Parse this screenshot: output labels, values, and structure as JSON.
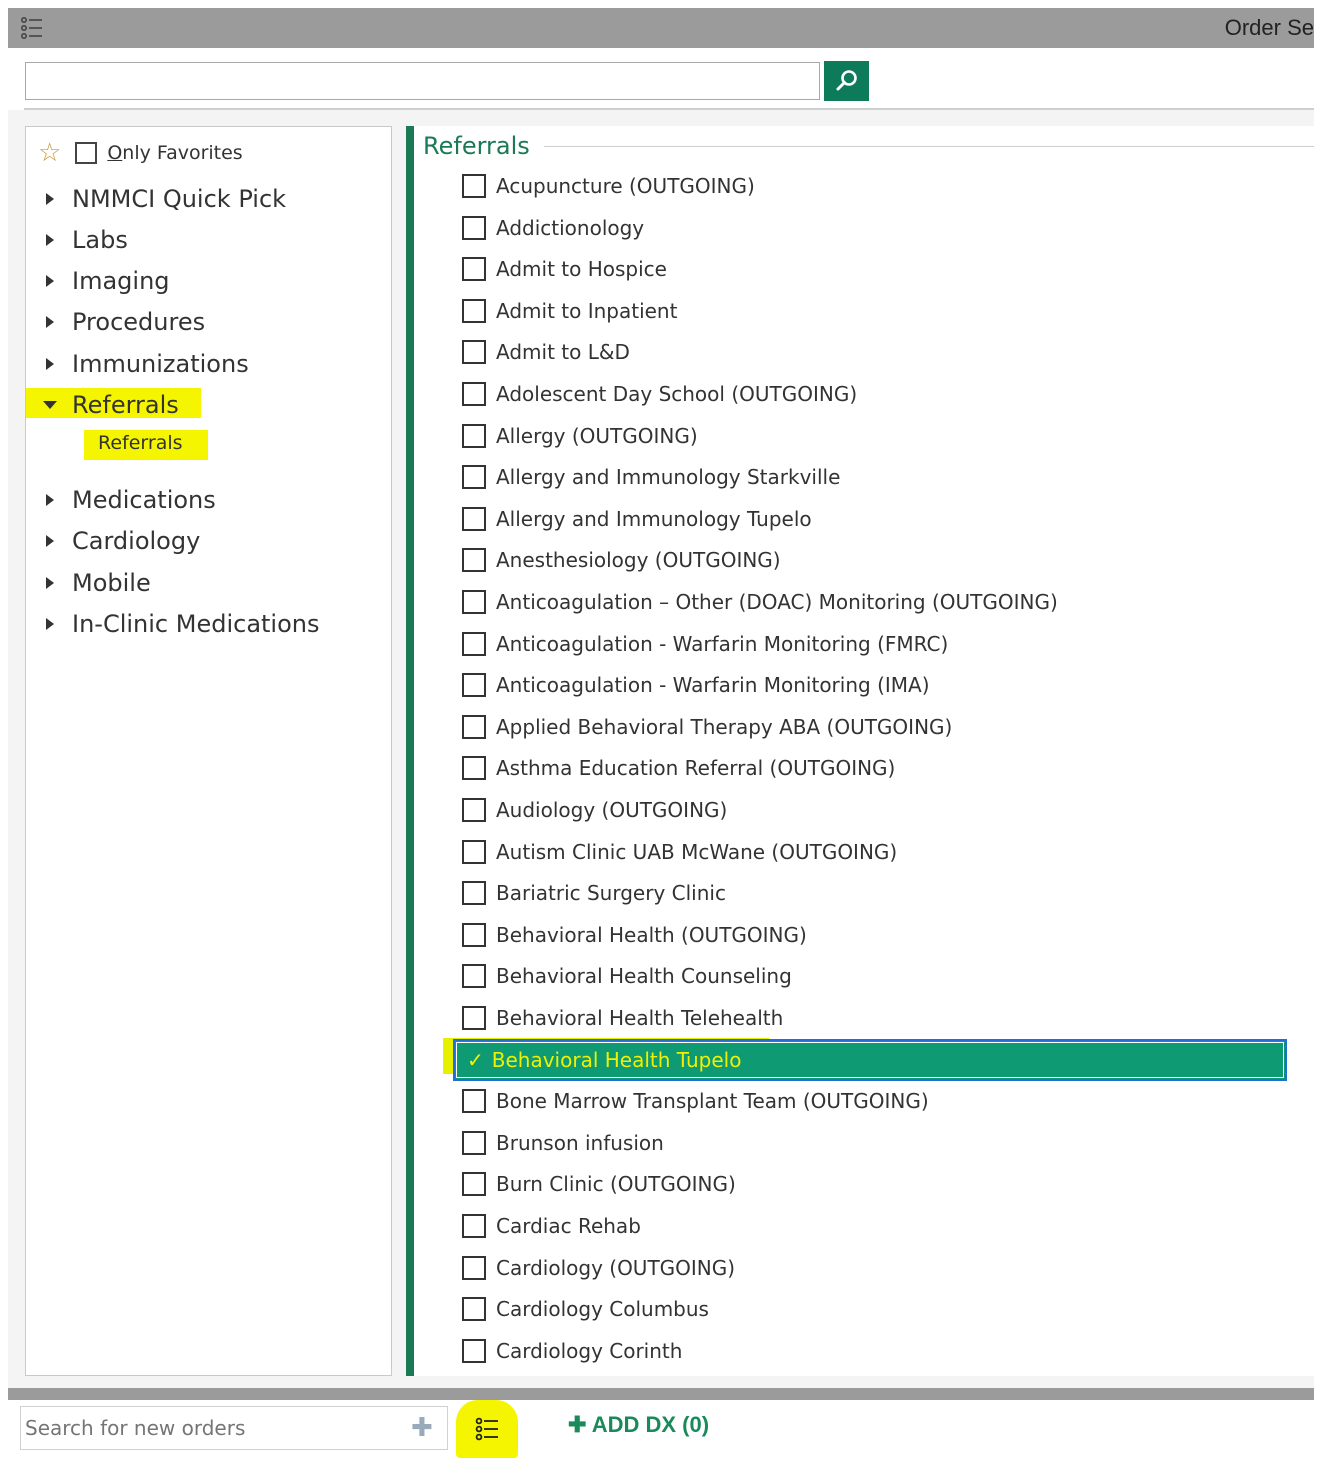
{
  "window": {
    "title": "Order Se"
  },
  "search": {
    "value": "",
    "placeholder": ""
  },
  "favorites": {
    "label_u": "O",
    "label_rest": "nly Favorites",
    "checked": false
  },
  "tree": [
    {
      "label": "NMMCI Quick Pick",
      "expanded": false
    },
    {
      "label": "Labs",
      "expanded": false
    },
    {
      "label": "Imaging",
      "expanded": false
    },
    {
      "label": "Procedures",
      "expanded": false
    },
    {
      "label": "Immunizations",
      "expanded": false
    },
    {
      "label": "Referrals",
      "expanded": true,
      "children": [
        "Referrals"
      ]
    },
    {
      "label": "Medications",
      "expanded": false
    },
    {
      "label": "Cardiology",
      "expanded": false
    },
    {
      "label": "Mobile",
      "expanded": false
    },
    {
      "label": "In-Clinic Medications",
      "expanded": false
    }
  ],
  "section": {
    "title": "Referrals"
  },
  "orders": [
    {
      "label": "Acupuncture (OUTGOING)",
      "checked": false
    },
    {
      "label": "Addictionology",
      "checked": false
    },
    {
      "label": "Admit to Hospice",
      "checked": false
    },
    {
      "label": "Admit to Inpatient",
      "checked": false
    },
    {
      "label": "Admit to L&D",
      "checked": false
    },
    {
      "label": "Adolescent Day School (OUTGOING)",
      "checked": false
    },
    {
      "label": "Allergy (OUTGOING)",
      "checked": false
    },
    {
      "label": "Allergy and Immunology Starkville",
      "checked": false
    },
    {
      "label": "Allergy and Immunology Tupelo",
      "checked": false
    },
    {
      "label": "Anesthesiology (OUTGOING)",
      "checked": false
    },
    {
      "label": "Anticoagulation – Other (DOAC) Monitoring (OUTGOING)",
      "checked": false
    },
    {
      "label": "Anticoagulation - Warfarin Monitoring (FMRC)",
      "checked": false
    },
    {
      "label": "Anticoagulation - Warfarin Monitoring (IMA)",
      "checked": false
    },
    {
      "label": "Applied Behavioral Therapy ABA (OUTGOING)",
      "checked": false
    },
    {
      "label": "Asthma Education Referral (OUTGOING)",
      "checked": false
    },
    {
      "label": "Audiology (OUTGOING)",
      "checked": false
    },
    {
      "label": "Autism Clinic UAB McWane (OUTGOING)",
      "checked": false
    },
    {
      "label": "Bariatric Surgery Clinic",
      "checked": false
    },
    {
      "label": "Behavioral Health (OUTGOING)",
      "checked": false
    },
    {
      "label": "Behavioral Health Counseling",
      "checked": false
    },
    {
      "label": "Behavioral Health Telehealth",
      "checked": false
    },
    {
      "label": "Behavioral Health Tupelo",
      "checked": true
    },
    {
      "label": "Bone Marrow Transplant Team (OUTGOING)",
      "checked": false
    },
    {
      "label": "Brunson infusion",
      "checked": false
    },
    {
      "label": "Burn Clinic (OUTGOING)",
      "checked": false
    },
    {
      "label": "Cardiac Rehab",
      "checked": false
    },
    {
      "label": "Cardiology (OUTGOING)",
      "checked": false
    },
    {
      "label": "Cardiology Columbus",
      "checked": false
    },
    {
      "label": "Cardiology Corinth",
      "checked": false
    }
  ],
  "bottom": {
    "search_placeholder": "Search for new orders",
    "add_dx_label": "ADD DX (0)"
  },
  "colors": {
    "accent_green": "#1a7a55",
    "selected_row": "#0e9a72",
    "highlight_yellow": "#f5f500",
    "titlebar_gray": "#9b9b9b"
  },
  "icons": [
    "list-menu-icon",
    "search-icon",
    "star-icon",
    "plus-icon",
    "checkmark-icon",
    "order-list-icon",
    "add-plus-icon"
  ]
}
